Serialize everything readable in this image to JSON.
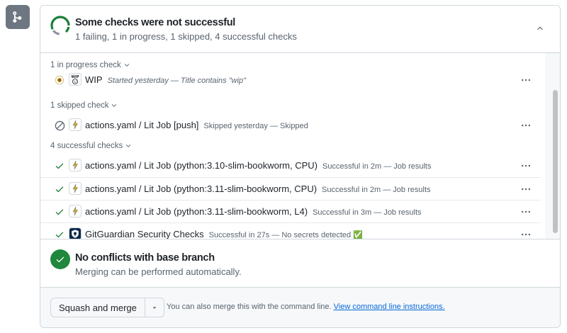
{
  "header": {
    "title": "Some checks were not successful",
    "subtitle": "1 failing, 1 in progress, 1 skipped, 4 successful checks"
  },
  "groups": {
    "in_progress": "1 in progress check",
    "skipped": "1 skipped check",
    "successful": "4 successful checks"
  },
  "checks": [
    {
      "name": "WIP",
      "description": "Started yesterday — Title contains \"wip\"",
      "status": "in-progress",
      "app_icon": "wip-icon"
    },
    {
      "name": "actions.yaml / Lit Job [push]",
      "description": "Skipped yesterday — Skipped",
      "status": "skipped",
      "app_icon": "actions-icon"
    },
    {
      "name": "actions.yaml / Lit Job (python:3.10-slim-bookworm, CPU)",
      "description": "Successful in 2m — Job results",
      "status": "success",
      "app_icon": "actions-icon"
    },
    {
      "name": "actions.yaml / Lit Job (python:3.11-slim-bookworm, CPU)",
      "description": "Successful in 2m — Job results",
      "status": "success",
      "app_icon": "actions-icon"
    },
    {
      "name": "actions.yaml / Lit Job (python:3.11-slim-bookworm, L4)",
      "description": "Successful in 3m — Job results",
      "status": "success",
      "app_icon": "actions-icon"
    },
    {
      "name": "GitGuardian Security Checks",
      "description": "Successful in 27s — No secrets detected ✅",
      "status": "success",
      "app_icon": "gitguardian-icon"
    }
  ],
  "conflicts": {
    "title": "No conflicts with base branch",
    "subtitle": "Merging can be performed automatically."
  },
  "footer": {
    "merge_label": "Squash and merge",
    "text": "You can also merge this with the command line.",
    "link": "View command line instructions."
  },
  "colors": {
    "success": "#1a7f37",
    "failure": "#cf222e",
    "pending": "#9a6700",
    "muted": "#59636e",
    "link": "#0969da",
    "merge_badge": "#6e7781"
  }
}
